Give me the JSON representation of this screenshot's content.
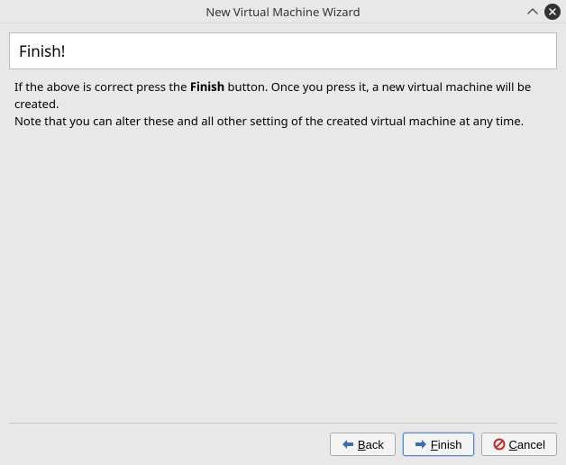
{
  "window": {
    "title": "New Virtual Machine Wizard"
  },
  "page": {
    "heading": "Finish!",
    "body": {
      "line1_pre": "If the above is correct press the ",
      "line1_bold": "Finish",
      "line1_post": " button. Once you press it, a new virtual machine will be created.",
      "line2": "Note that you can alter these and all other setting of the created virtual machine at any time."
    }
  },
  "buttons": {
    "back": {
      "mnemonic": "B",
      "rest": "ack"
    },
    "finish": {
      "mnemonic": "F",
      "rest": "inish"
    },
    "cancel": {
      "mnemonic": "C",
      "rest": "ancel"
    }
  }
}
